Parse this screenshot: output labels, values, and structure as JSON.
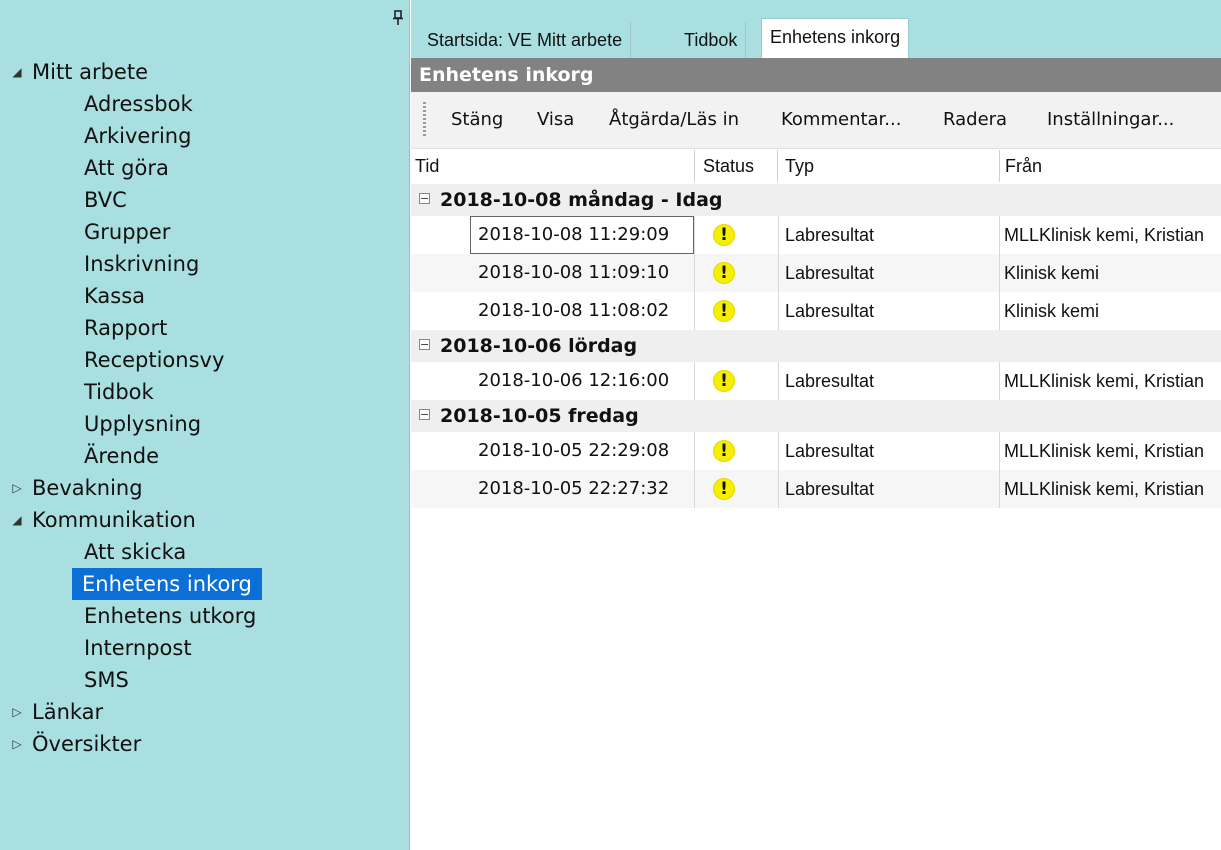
{
  "pin_icon": "pin-icon",
  "sidebar": {
    "items": [
      {
        "label": "Mitt arbete",
        "level": 0,
        "expanded": true
      },
      {
        "label": "Adressbok",
        "level": 1
      },
      {
        "label": "Arkivering",
        "level": 1
      },
      {
        "label": "Att göra",
        "level": 1
      },
      {
        "label": "BVC",
        "level": 1
      },
      {
        "label": "Grupper",
        "level": 1
      },
      {
        "label": "Inskrivning",
        "level": 1
      },
      {
        "label": "Kassa",
        "level": 1
      },
      {
        "label": "Rapport",
        "level": 1
      },
      {
        "label": "Receptionsvy",
        "level": 1
      },
      {
        "label": "Tidbok",
        "level": 1
      },
      {
        "label": "Upplysning",
        "level": 1
      },
      {
        "label": "Ärende",
        "level": 1
      },
      {
        "label": "Bevakning",
        "level": 0,
        "expanded": false
      },
      {
        "label": "Kommunikation",
        "level": 0,
        "expanded": true
      },
      {
        "label": "Att skicka",
        "level": 1
      },
      {
        "label": "Enhetens inkorg",
        "level": 1,
        "selected": true
      },
      {
        "label": "Enhetens utkorg",
        "level": 1
      },
      {
        "label": "Internpost",
        "level": 1
      },
      {
        "label": "SMS",
        "level": 1
      },
      {
        "label": "Länkar",
        "level": 0,
        "expanded": false
      },
      {
        "label": "Översikter",
        "level": 0,
        "expanded": false
      }
    ],
    "arrows": {
      "expanded": "◢",
      "collapsed": "▷"
    },
    "selected_color": "#0a6fd6",
    "background_color": "#a9dfe0"
  },
  "tabs": [
    {
      "label": "Startsida: VE Mitt arbete",
      "active": false
    },
    {
      "label": "Tidbok",
      "active": false
    },
    {
      "label": "Enhetens inkorg",
      "active": true
    }
  ],
  "panel": {
    "title": "Enhetens inkorg"
  },
  "toolbar": {
    "buttons": [
      "Stäng",
      "Visa",
      "Åtgärda/Läs in",
      "Kommentar...",
      "Radera",
      "Inställningar..."
    ]
  },
  "table": {
    "columns": {
      "time": "Tid",
      "status": "Status",
      "type": "Typ",
      "from": "Från"
    },
    "groups": [
      {
        "label": "2018-10-08  måndag - Idag",
        "rows": [
          {
            "time": "2018-10-08 11:29:09",
            "status_icon": "warning-icon",
            "type": "Labresultat",
            "from": "MLLKlinisk kemi, Kristian"
          },
          {
            "time": "2018-10-08 11:09:10",
            "status_icon": "warning-icon",
            "type": "Labresultat",
            "from": "Klinisk kemi"
          },
          {
            "time": "2018-10-08 11:08:02",
            "status_icon": "warning-icon",
            "type": "Labresultat",
            "from": "Klinisk kemi"
          }
        ]
      },
      {
        "label": "2018-10-06  lördag",
        "rows": [
          {
            "time": "2018-10-06 12:16:00",
            "status_icon": "warning-icon",
            "type": "Labresultat",
            "from": "MLLKlinisk kemi, Kristian"
          }
        ]
      },
      {
        "label": "2018-10-05  fredag",
        "rows": [
          {
            "time": "2018-10-05 22:29:08",
            "status_icon": "warning-icon",
            "type": "Labresultat",
            "from": "MLLKlinisk kemi, Kristian"
          },
          {
            "time": "2018-10-05 22:27:32",
            "status_icon": "warning-icon",
            "type": "Labresultat",
            "from": "MLLKlinisk kemi, Kristian"
          }
        ]
      }
    ],
    "group_toggle": "−",
    "warning_glyph": "!",
    "warning_color": "#f5f000"
  }
}
